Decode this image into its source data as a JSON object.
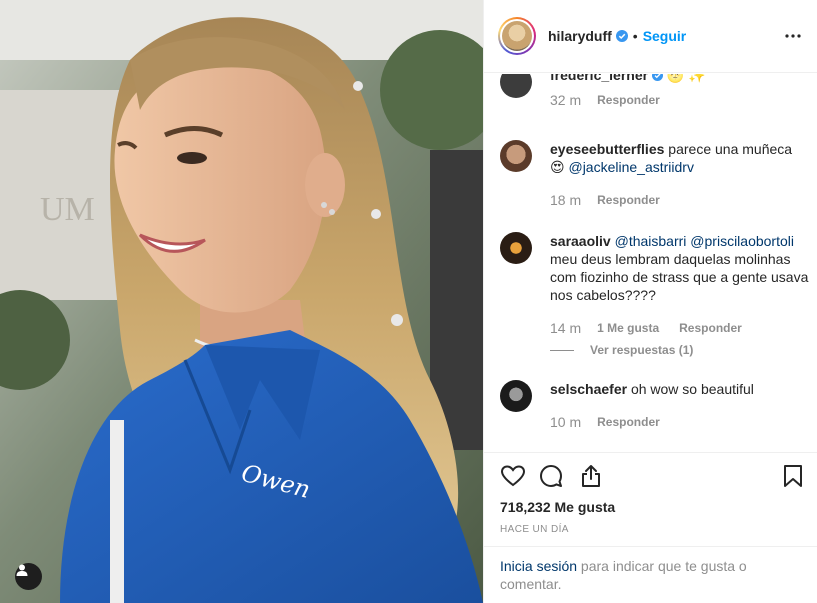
{
  "post": {
    "username": "hilaryduff",
    "follow_label": "Seguir",
    "separator": "•",
    "likes": "718,232 Me gusta",
    "time_ago": "HACE UN DÍA"
  },
  "comments": [
    {
      "user": "frederic_lerner",
      "text": " 🌝 ✨",
      "time": "32 m",
      "reply": "Responder"
    },
    {
      "user": "eyeseebutterflies",
      "text": " parece una muñeca 😍 ",
      "mention": "@jackeline_astriidrv",
      "time": "18 m",
      "reply": "Responder"
    },
    {
      "user": "saraaoliv",
      "mention1": "@thaisbarri",
      "mention2": "@priscilaobortoli",
      "text": " meu deus lembram daquelas molinhas com fiozinho de strass que a gente usava nos cabelos????",
      "time": "14 m",
      "likes": "1 Me gusta",
      "reply": "Responder",
      "view_replies": "Ver respuestas (1)"
    },
    {
      "user": "selschaefer",
      "text": " oh wow so beautiful",
      "time": "10 m",
      "reply": "Responder"
    }
  ],
  "login_prompt": {
    "link": "Inicia sesión",
    "text": " para indicar que te gusta o comentar."
  },
  "icons": {
    "verified": "verified-badge-icon",
    "more": "more-options-icon",
    "like": "heart-icon",
    "comment": "comment-bubble-icon",
    "share": "share-icon",
    "save": "bookmark-icon",
    "user_tag": "user-tag-icon"
  },
  "colors": {
    "accent": "#0095f6",
    "mention": "#00376b",
    "text": "#262626",
    "muted": "#8e8e8e",
    "shirt": "#1f5fb5"
  }
}
